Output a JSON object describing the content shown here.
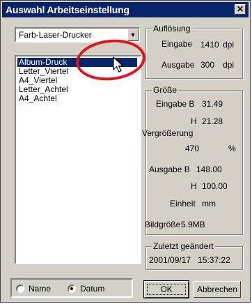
{
  "window": {
    "title": "Auswahl Arbeitseinstellung",
    "close_glyph": "✕"
  },
  "printer_select": {
    "value": "Farb-Laser-Drucker",
    "arrow": "▼"
  },
  "settings_list": {
    "items": [
      "Album-Druck",
      "Letter_Viertel",
      "A4_Viertel",
      "Letter_Achtel",
      "A4_Achtel"
    ],
    "selected_index": 0
  },
  "resolution": {
    "label": "Auflösung",
    "input_label": "Eingabe",
    "input_value": "1410",
    "input_unit": "dpi",
    "output_label": "Ausgabe",
    "output_value": "300",
    "output_unit": "dpi"
  },
  "size": {
    "label": "Größe",
    "input_w_label": "Eingabe B",
    "input_w_value": "31.49",
    "input_h_label": "H",
    "input_h_value": "21.28",
    "zoom_label": "Vergrößerung",
    "zoom_value": "470",
    "zoom_unit": "%",
    "output_w_label": "Ausgabe B",
    "output_w_value": "148.00",
    "output_h_label": "H",
    "output_h_value": "100.00",
    "unit_label": "Einheit",
    "unit_value": "mm",
    "image_size_label": "Bildgröße",
    "image_size_value": "5.9MB"
  },
  "last_changed": {
    "label": "Zuletzt geändert",
    "value": "2001/09/17   15:37:22"
  },
  "sort": {
    "name_label": "Name",
    "date_label": "Datum",
    "selected": "Datum"
  },
  "buttons": {
    "ok": "OK",
    "cancel": "Abbrechen"
  },
  "colors": {
    "titlebar": "#0a246a",
    "highlight_circle": "#e0141c",
    "face": "#d4d0c8"
  }
}
